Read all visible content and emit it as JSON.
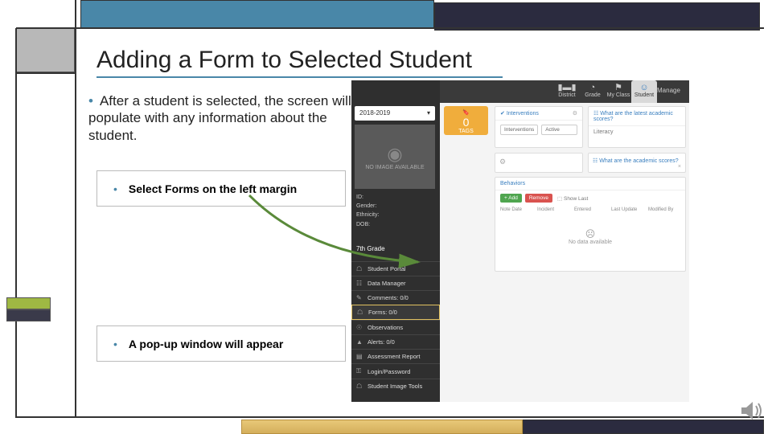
{
  "title": "Adding a Form to Selected Student",
  "bullets": {
    "b1": "After a student is selected, the screen will populate with any information about the student.",
    "b2": "Select Forms on the left margin",
    "b3": "A pop-up window will appear"
  },
  "app": {
    "topnav": {
      "district": "District",
      "grade": "Grade",
      "myclass": "My Class",
      "student": "Student",
      "manage": "Manage"
    },
    "year": "2018-2019",
    "no_image": "NO IMAGE AVAILABLE",
    "info": {
      "id": "ID:",
      "gender": "Gender:",
      "ethnic": "Ethnicity:",
      "dob": "DOB:"
    },
    "grade_label": "7th Grade",
    "menu": {
      "portal": "Student Portal",
      "data": "Data Manager",
      "comments": "Comments: 0/0",
      "forms": "Forms: 0/0",
      "obs": "Observations",
      "alerts": "Alerts: 0/0",
      "assess": "Assessment Report",
      "login": "Login/Password",
      "image": "Student Image Tools"
    },
    "tag": {
      "count": "0",
      "label": "TAGS"
    },
    "panels": {
      "interventions": {
        "title": "Interventions",
        "c1": "Interventions",
        "c2": "Active"
      },
      "scores": {
        "title": "What are the latest academic scores?",
        "row": "Literacy"
      },
      "acad": "What are the academic scores?",
      "behaviors": {
        "title": "Behaviors",
        "add": "+ Add",
        "remove": "Remove",
        "show_last": "Show Last",
        "cols": [
          "Note Date",
          "Incident",
          "Entered",
          "Last Update",
          "Modified By"
        ],
        "empty": "No data available"
      }
    }
  }
}
